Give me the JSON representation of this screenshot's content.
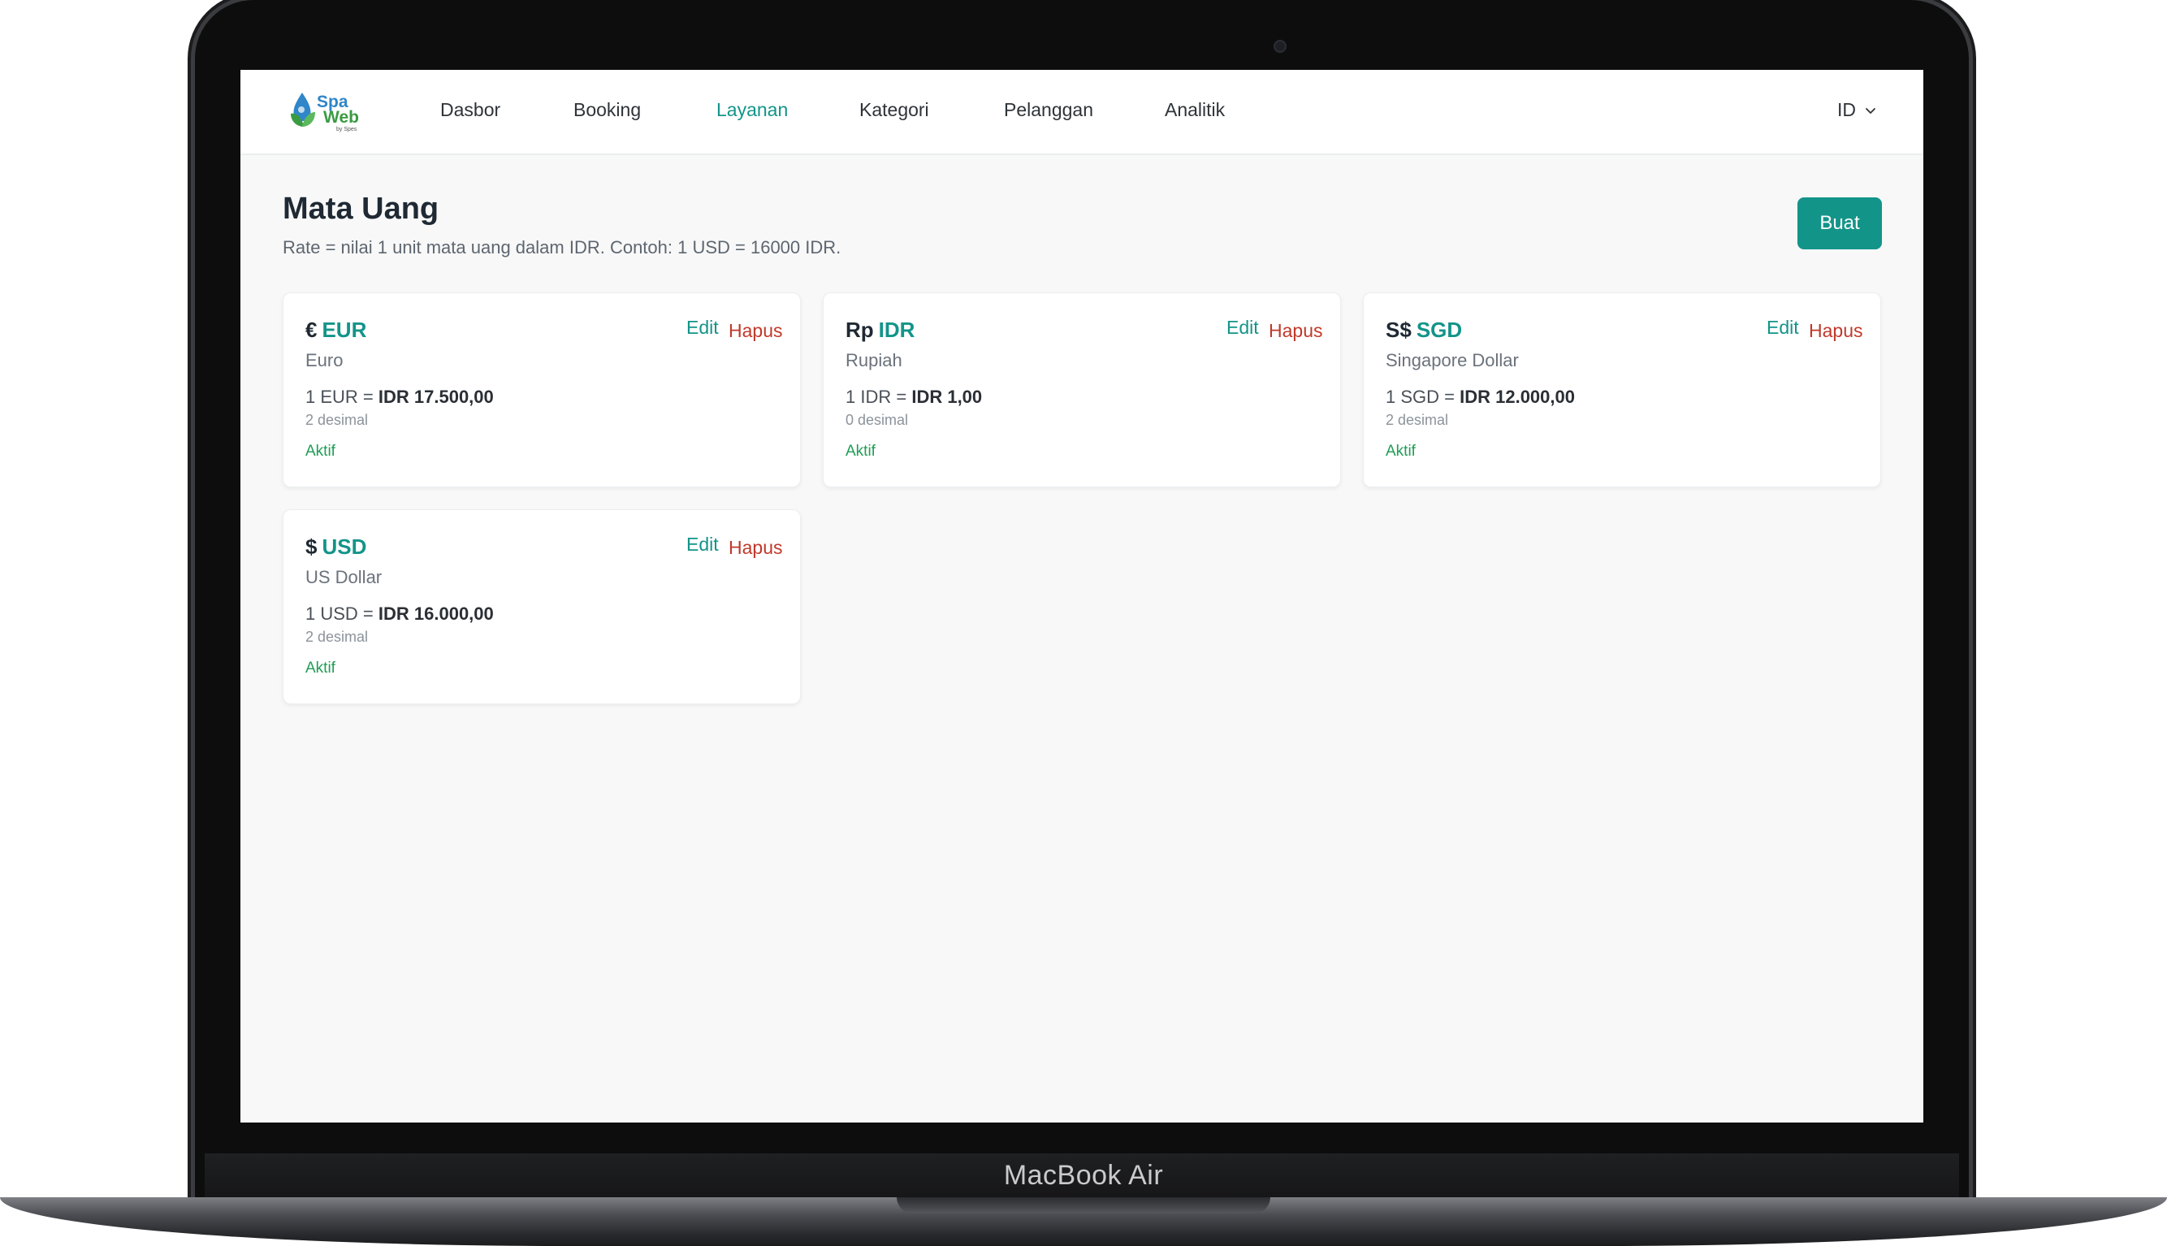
{
  "device": {
    "label": "MacBook Air"
  },
  "nav": {
    "logo": {
      "line1": "Spa",
      "line2": "Web",
      "tagline": "by Spes"
    },
    "items": [
      {
        "label": "Dasbor",
        "active": false
      },
      {
        "label": "Booking",
        "active": false
      },
      {
        "label": "Layanan",
        "active": true
      },
      {
        "label": "Kategori",
        "active": false
      },
      {
        "label": "Pelanggan",
        "active": false
      },
      {
        "label": "Analitik",
        "active": false
      }
    ],
    "language": "ID"
  },
  "page": {
    "title": "Mata Uang",
    "subtitle": "Rate = nilai 1 unit mata uang dalam IDR. Contoh: 1 USD = 16000 IDR.",
    "create_label": "Buat"
  },
  "currencies": [
    {
      "symbol": "€",
      "code": "EUR",
      "name": "Euro",
      "rate_prefix": "1 EUR =",
      "rate_value": "IDR 17.500,00",
      "decimals": "2 desimal",
      "status": "Aktif",
      "edit_label": "Edit",
      "delete_label": "Hapus"
    },
    {
      "symbol": "Rp",
      "code": "IDR",
      "name": "Rupiah",
      "rate_prefix": "1 IDR =",
      "rate_value": "IDR 1,00",
      "decimals": "0 desimal",
      "status": "Aktif",
      "edit_label": "Edit",
      "delete_label": "Hapus"
    },
    {
      "symbol": "S$",
      "code": "SGD",
      "name": "Singapore Dollar",
      "rate_prefix": "1 SGD =",
      "rate_value": "IDR 12.000,00",
      "decimals": "2 desimal",
      "status": "Aktif",
      "edit_label": "Edit",
      "delete_label": "Hapus"
    },
    {
      "symbol": "$",
      "code": "USD",
      "name": "US Dollar",
      "rate_prefix": "1 USD =",
      "rate_value": "IDR 16.000,00",
      "decimals": "2 desimal",
      "status": "Aktif",
      "edit_label": "Edit",
      "delete_label": "Hapus"
    }
  ],
  "colors": {
    "accent": "#139489",
    "danger": "#c0392b",
    "success": "#1f9d55"
  }
}
